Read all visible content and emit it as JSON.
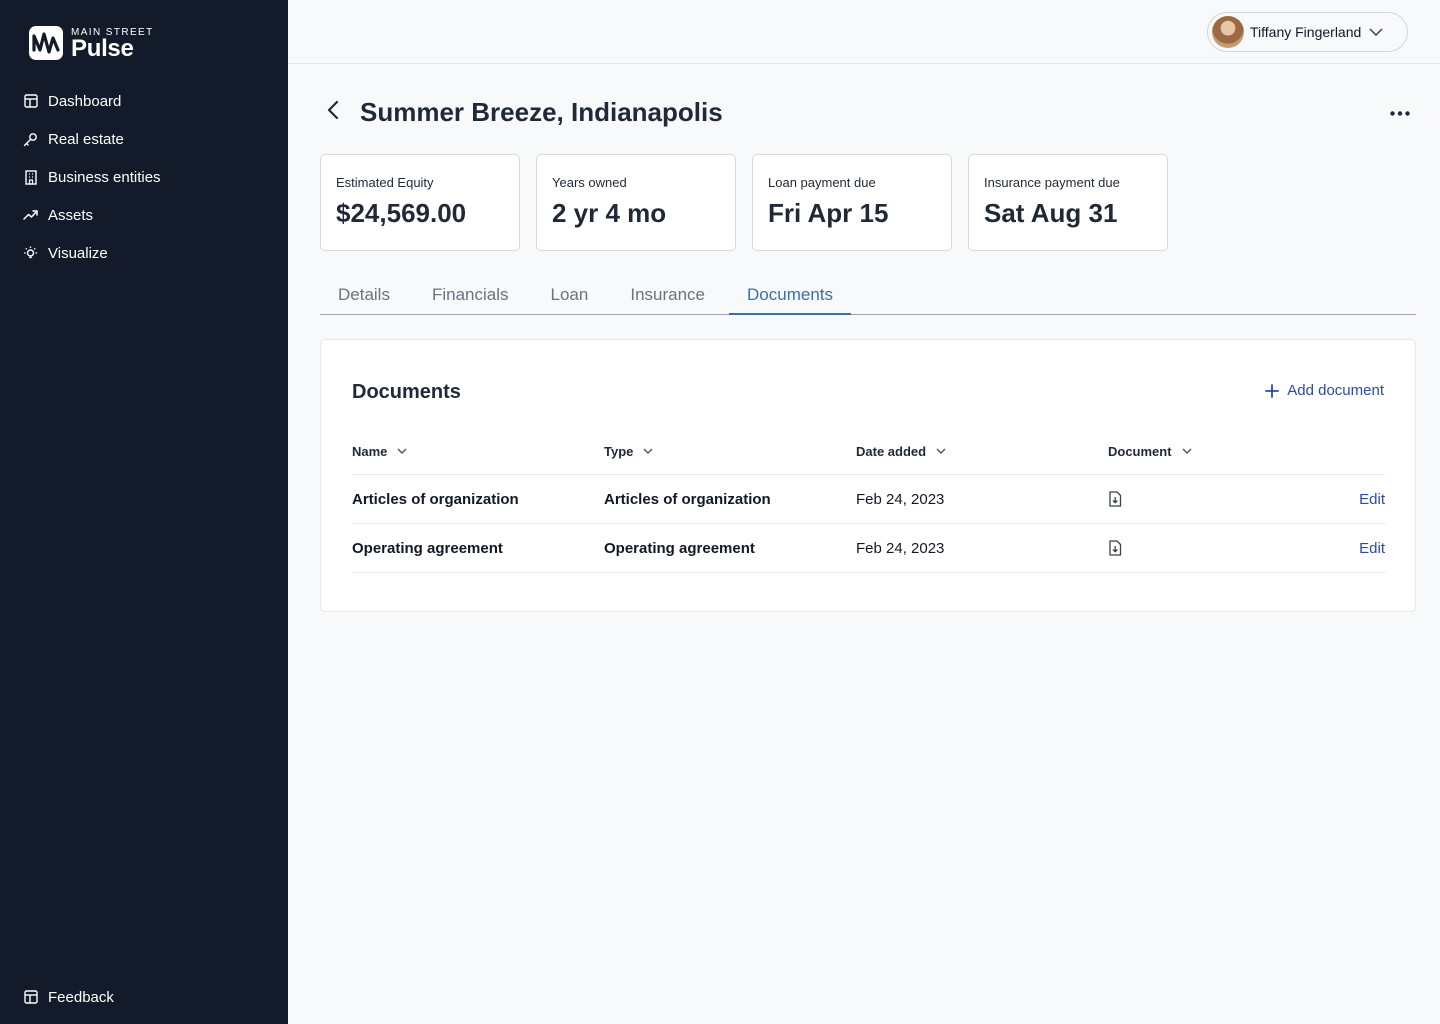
{
  "brand": {
    "line1": "MAIN STREET",
    "line2": "Pulse"
  },
  "sidebar": {
    "items": [
      {
        "label": "Dashboard",
        "icon": "layout-icon"
      },
      {
        "label": "Real estate",
        "icon": "key-icon"
      },
      {
        "label": "Business entities",
        "icon": "building-icon"
      },
      {
        "label": "Assets",
        "icon": "trending-up-icon"
      },
      {
        "label": "Visualize",
        "icon": "lightbulb-icon"
      }
    ],
    "feedback": {
      "label": "Feedback",
      "icon": "layout-icon"
    }
  },
  "user": {
    "name": "Tiffany Fingerland"
  },
  "page": {
    "title": "Summer Breeze, Indianapolis"
  },
  "stats": [
    {
      "label": "Estimated Equity",
      "value": "$24,569.00"
    },
    {
      "label": "Years owned",
      "value": "2 yr 4 mo"
    },
    {
      "label": "Loan payment due",
      "value": "Fri Apr 15"
    },
    {
      "label": "Insurance payment due",
      "value": "Sat Aug 31"
    }
  ],
  "tabs": [
    "Details",
    "Financials",
    "Loan",
    "Insurance",
    "Documents"
  ],
  "active_tab": "Documents",
  "documents": {
    "title": "Documents",
    "add_label": "Add document",
    "columns": [
      "Name",
      "Type",
      "Date added",
      "Document"
    ],
    "rows": [
      {
        "name": "Articles of organization",
        "type": "Articles of organization",
        "date": "Feb 24, 2023",
        "action": "Edit"
      },
      {
        "name": "Operating agreement",
        "type": "Operating agreement",
        "date": "Feb 24, 2023",
        "action": "Edit"
      }
    ]
  },
  "colors": {
    "sidebar_bg": "#131a29",
    "accent_tab": "#3b6ea8",
    "link": "#2b4aa8"
  }
}
